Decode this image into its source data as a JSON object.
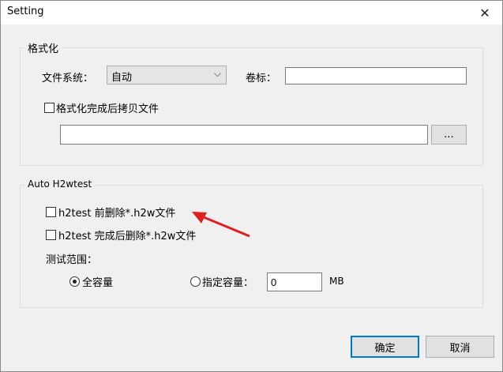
{
  "window": {
    "title": "Setting",
    "close_glyph": "✕"
  },
  "format": {
    "legend": "格式化",
    "fs_label": "文件系统：",
    "fs_value": "自动",
    "volume_label": "卷标：",
    "volume_value": "",
    "copy_after_label": "格式化完成后拷贝文件",
    "copy_after_checked": false,
    "path_value": "",
    "browse_label": "..."
  },
  "auto": {
    "legend": "Auto H2wtest",
    "delete_before_label": "h2test 前删除*.h2w文件",
    "delete_before_checked": false,
    "delete_after_label": "h2test 完成后删除*.h2w文件",
    "delete_after_checked": false,
    "range_label": "测试范围：",
    "radio_full_label": "全容量",
    "radio_full_checked": true,
    "radio_custom_label": "指定容量：",
    "radio_custom_checked": false,
    "capacity_value": "0",
    "capacity_unit": "MB"
  },
  "buttons": {
    "ok": "确定",
    "cancel": "取消"
  },
  "annotation": {
    "arrow_color": "#e02020"
  }
}
